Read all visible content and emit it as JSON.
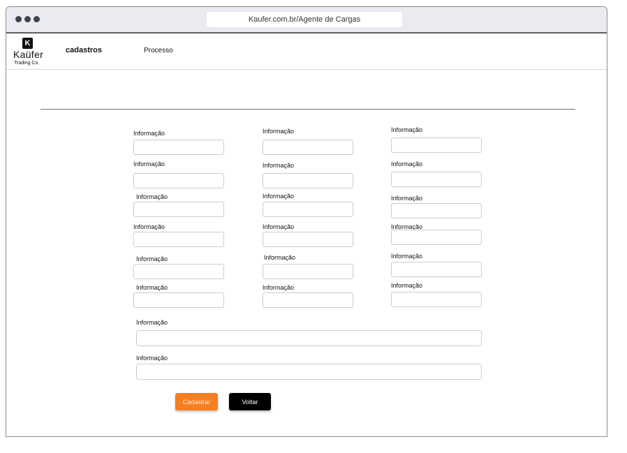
{
  "browser": {
    "url": "Kaufer.com.br/Agente de Cargas"
  },
  "logo": {
    "mark": "K",
    "name": "Kaüfer",
    "sub": "Trading Co."
  },
  "nav": {
    "cadastros": "cadastros",
    "processo": "Processo"
  },
  "form": {
    "fields": [
      {
        "label": "Informação",
        "value": ""
      },
      {
        "label": "Informação",
        "value": ""
      },
      {
        "label": "Informação",
        "value": ""
      },
      {
        "label": "Informação",
        "value": ""
      },
      {
        "label": "Informação",
        "value": ""
      },
      {
        "label": "Informação",
        "value": ""
      },
      {
        "label": "Informação",
        "value": ""
      },
      {
        "label": "Informação",
        "value": ""
      },
      {
        "label": "Informação",
        "value": ""
      },
      {
        "label": "Informação",
        "value": ""
      },
      {
        "label": "Informação",
        "value": ""
      },
      {
        "label": "Informação",
        "value": ""
      },
      {
        "label": "Informação",
        "value": ""
      },
      {
        "label": "Informação",
        "value": ""
      },
      {
        "label": "Informação",
        "value": ""
      },
      {
        "label": "Informação",
        "value": ""
      },
      {
        "label": "Informação",
        "value": ""
      },
      {
        "label": "Informação",
        "value": ""
      },
      {
        "label": "Informação",
        "value": ""
      },
      {
        "label": "Informação",
        "value": ""
      }
    ]
  },
  "actions": {
    "submit": "Cadastrar",
    "back": "Voltar"
  },
  "colors": {
    "accent": "#f47f24",
    "secondary": "#000000"
  }
}
